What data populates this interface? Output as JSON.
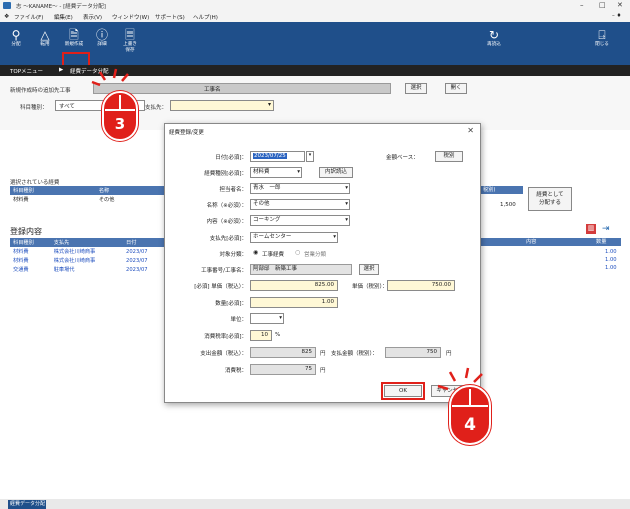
{
  "window": {
    "title": "志 ～KANAME～ - [経費データ分配]",
    "minimize": "–",
    "maximize": "□",
    "close": "✕"
  },
  "menu": [
    "ファイル(F)",
    "編集(E)",
    "表示(V)",
    "ウィンドウ(W)",
    "サポート(S)",
    "ヘルプ(H)"
  ],
  "toolbar": {
    "split": "分配",
    "transfer": "転用",
    "new": "新規作成",
    "detail": "詳細",
    "overwrite_save": "上書き\n保存",
    "reload": "再読込",
    "close": "閉じる"
  },
  "breadcrumb": {
    "top": "TOPメニュー",
    "sep": "▶",
    "current": "経費データ分配"
  },
  "filters": {
    "target_project_label": "新規作成時の追加先工事",
    "project_name_header": "工事名",
    "select_btn": "選択",
    "open_btn": "開く",
    "category_label": "科目種別：",
    "category_value": "すべて",
    "payee_label": "支払先："
  },
  "selected_section": {
    "title": "選択されている経費",
    "headers": [
      "科目種別",
      "名称"
    ],
    "row": [
      "材料費",
      "その他"
    ],
    "tax_header": "税別)",
    "amount": "1,500",
    "split_btn": "経費として\n分配する"
  },
  "registered": {
    "title": "登録内容",
    "headers": [
      "科目種別",
      "支払先",
      "日付"
    ],
    "right_headers": [
      "内容",
      "数量"
    ],
    "rows": [
      {
        "cat": "材料費",
        "payee": "株式会社川崎商事",
        "date": "2023/07",
        "qty": "1.00"
      },
      {
        "cat": "材料費",
        "payee": "株式会社川崎商事",
        "date": "2023/07",
        "qty": "1.00"
      },
      {
        "cat": "交通費",
        "payee": "駐車場代",
        "date": "2023/07",
        "qty": "1.00"
      }
    ]
  },
  "dialog": {
    "title": "経費登録/変更",
    "date_label": "日付[必須]：",
    "date_value": "2023/07/25",
    "amount_base_label": "金額ベース：",
    "amount_base_value": "税別",
    "expense_type_label": "経費種別[必須]：",
    "expense_type_value": "材料費",
    "internal_read_btn": "内訳読込",
    "person_label": "担当者名：",
    "person_value": "青水　一郎",
    "name_label": "名称（※必須）：",
    "name_value": "その他",
    "content_label": "内容（※必須）：",
    "content_value": "コーキング",
    "payee_label": "支払先[必須]：",
    "payee_value": "ホームセンター",
    "target_label": "対象分類：",
    "target_opt1": "工事経費",
    "target_opt2": "営業分類",
    "project_label": "工事番号/工事名：",
    "project_value": "阿部邸　新築工事",
    "project_select_btn": "選択",
    "unit_price_incl_label": "[必須] 単価（税込）：",
    "unit_price_incl_value": "825.00",
    "unit_price_excl_label": "単価（税別）：",
    "unit_price_excl_value": "750.00",
    "qty_label": "数量[必須]：",
    "qty_value": "1.00",
    "unit_label": "単位：",
    "tax_rate_label": "消費税率[必須]：",
    "tax_rate_value": "10",
    "tax_rate_unit": "%",
    "pay_incl_label": "支出金額（税込）：",
    "pay_incl_value": "825",
    "pay_excl_label": "支払金額（税別）：",
    "pay_excl_value": "750",
    "yen": "円",
    "tax_amount_label": "消費税：",
    "tax_amount_value": "75",
    "ok_btn": "OK",
    "cancel_btn": "キャンセル",
    "close": "✕"
  },
  "callouts": {
    "step3": "3",
    "step4": "4"
  },
  "status_bar": {
    "tab": "経費データ分配"
  },
  "colors": {
    "toolbar": "#1f4f8a",
    "accent_red": "#e0201a",
    "input_yellow": "#fff8d6",
    "blue_text": "#1f4fbf"
  }
}
